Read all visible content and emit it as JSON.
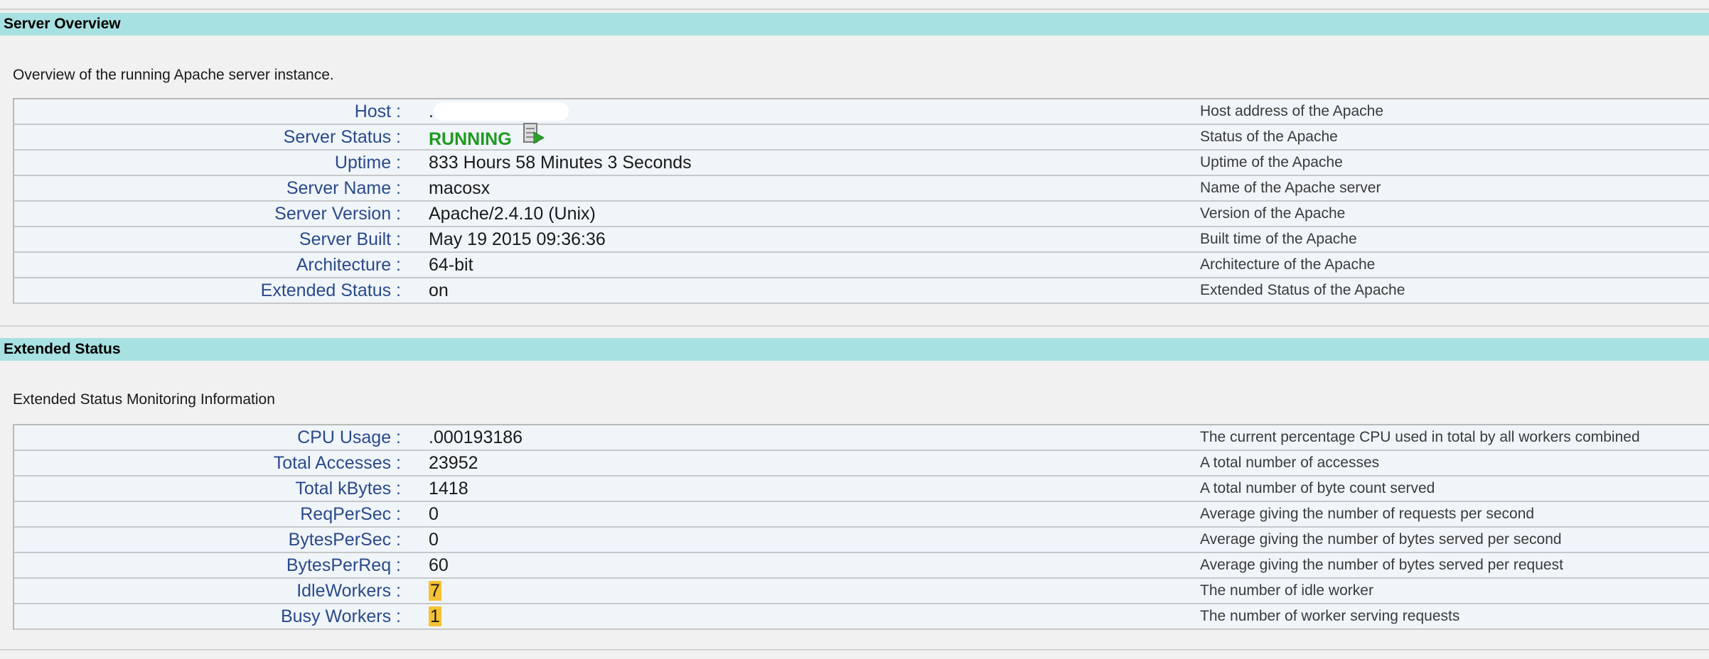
{
  "server_overview": {
    "title": "Server Overview",
    "description": "Overview of the running Apache server instance.",
    "rows": [
      {
        "label": "Host :",
        "value": ".",
        "note": "Host address of the Apache"
      },
      {
        "label": "Server Status :",
        "value": "RUNNING",
        "note": "Status of the Apache",
        "icon": "server-run-icon"
      },
      {
        "label": "Uptime :",
        "value": "833 Hours 58 Minutes 3 Seconds",
        "note": "Uptime of the Apache"
      },
      {
        "label": "Server Name :",
        "value": "macosx",
        "note": "Name of the Apache server"
      },
      {
        "label": "Server Version :",
        "value": "Apache/2.4.10 (Unix)",
        "note": "Version of the Apache"
      },
      {
        "label": "Server Built :",
        "value": "May 19 2015 09:36:36",
        "note": "Built time of the Apache"
      },
      {
        "label": "Architecture :",
        "value": "64-bit",
        "note": "Architecture of the Apache"
      },
      {
        "label": "Extended Status :",
        "value": "on",
        "note": "Extended Status of the Apache"
      }
    ]
  },
  "extended_status": {
    "title": "Extended Status",
    "description": "Extended Status Monitoring Information",
    "rows": [
      {
        "label": "CPU Usage :",
        "value": ".000193186",
        "note": "The current percentage CPU used in total by all workers combined"
      },
      {
        "label": "Total Accesses :",
        "value": "23952",
        "note": "A total number of accesses"
      },
      {
        "label": "Total kBytes :",
        "value": "1418",
        "note": "A total number of byte count served"
      },
      {
        "label": "ReqPerSec :",
        "value": "0",
        "note": "Average giving the number of requests per second"
      },
      {
        "label": "BytesPerSec :",
        "value": "0",
        "note": "Average giving the number of bytes served per second"
      },
      {
        "label": "BytesPerReq :",
        "value": "60",
        "note": "Average giving the number of bytes served per request"
      },
      {
        "label": "IdleWorkers :",
        "value": "7",
        "note": "The number of idle worker"
      },
      {
        "label": "Busy Workers :",
        "value": "1",
        "note": "The number of worker serving requests"
      }
    ]
  },
  "colors": {
    "header_bg": "#a8e1e1",
    "label": "#2a4a8a",
    "running": "#1f9a1f",
    "highlight": "#f6c233"
  }
}
